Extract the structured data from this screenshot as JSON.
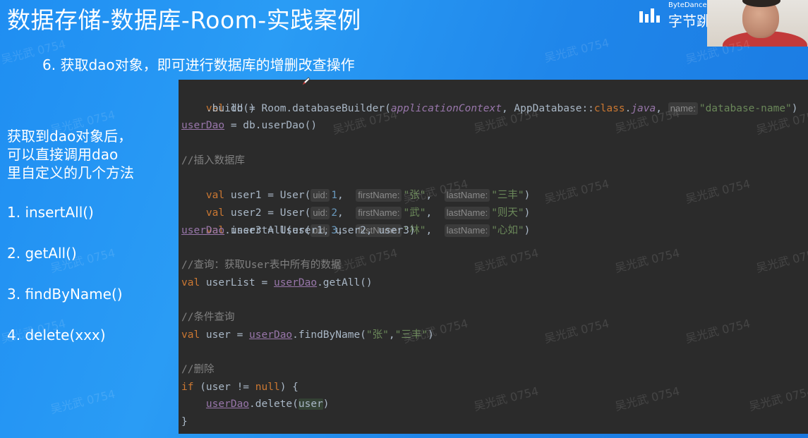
{
  "slide": {
    "title": "数据存储-数据库-Room-实践案例",
    "subtitle": "6. 获取dao对象，即可进行数据库的增删改查操作"
  },
  "sidebar": {
    "intro": [
      "获取到dao对象后，",
      "可以直接调用dao",
      "里自定义的几个方法"
    ],
    "methods": [
      "1. insertAll()",
      "2. getAll()",
      "3. findByName()",
      "4. delete(xxx)"
    ]
  },
  "brand": {
    "en": "ByteDance",
    "zh": "字节跳"
  },
  "watermark": "吴光武 0754",
  "code": {
    "l1": {
      "kw": "val",
      "a": " db = Room.databaseBuilder(",
      "ctx": "applicationContext",
      "b": ", AppDatabase::",
      "cls": "class",
      "dot": ".",
      "java": "java",
      "comma": ", ",
      "hint": "name:",
      "str": "\"database-name\"",
      "end": ")"
    },
    "l2": "    .build()",
    "l3": {
      "pv": "userDao",
      "rest": " = db.userDao()"
    },
    "c_insert": "//插入数据库",
    "users": [
      {
        "decl": " user1 = User(",
        "uid": "1",
        "first": "\"张\"",
        "last": "\"三丰\""
      },
      {
        "decl": " user2 = User(",
        "uid": "2",
        "first": "\"武\"",
        "last": "\"则天\""
      },
      {
        "decl": " user3 = User(",
        "uid": "3",
        "first": "\"林\"",
        "last": "\"心如\""
      }
    ],
    "hints": {
      "uid": "uid:",
      "first": "firstName:",
      "last": "lastName:"
    },
    "insert_call": ".insertAll(user1, user2, user3)",
    "c_query": "//查询：获取User表中所有的数据",
    "query_decl": " userList = ",
    "query_call": ".getAll()",
    "c_cond": "//条件查询",
    "cond_decl": " user = ",
    "cond_call_a": ".findByName(",
    "cond_arg1": "\"张\"",
    "cond_sep": ",",
    "cond_arg2": "\"三丰\"",
    "cond_end": ")",
    "c_delete": "//删除",
    "if_kw": "if",
    "if_a": " (user != ",
    "null_kw": "null",
    "if_b": ") {",
    "del_indent": "    ",
    "del_call": ".delete(",
    "del_arg": "user",
    "del_end": ")",
    "close": "}",
    "val_kw": "val",
    "dao_name": "userDao"
  },
  "colors": {
    "background": "#1f8ef2",
    "editor_bg": "#2b2b2b",
    "keyword": "#cc7832",
    "string": "#6a8759",
    "number": "#6897bb",
    "comment": "#808080",
    "property": "#9876aa"
  }
}
